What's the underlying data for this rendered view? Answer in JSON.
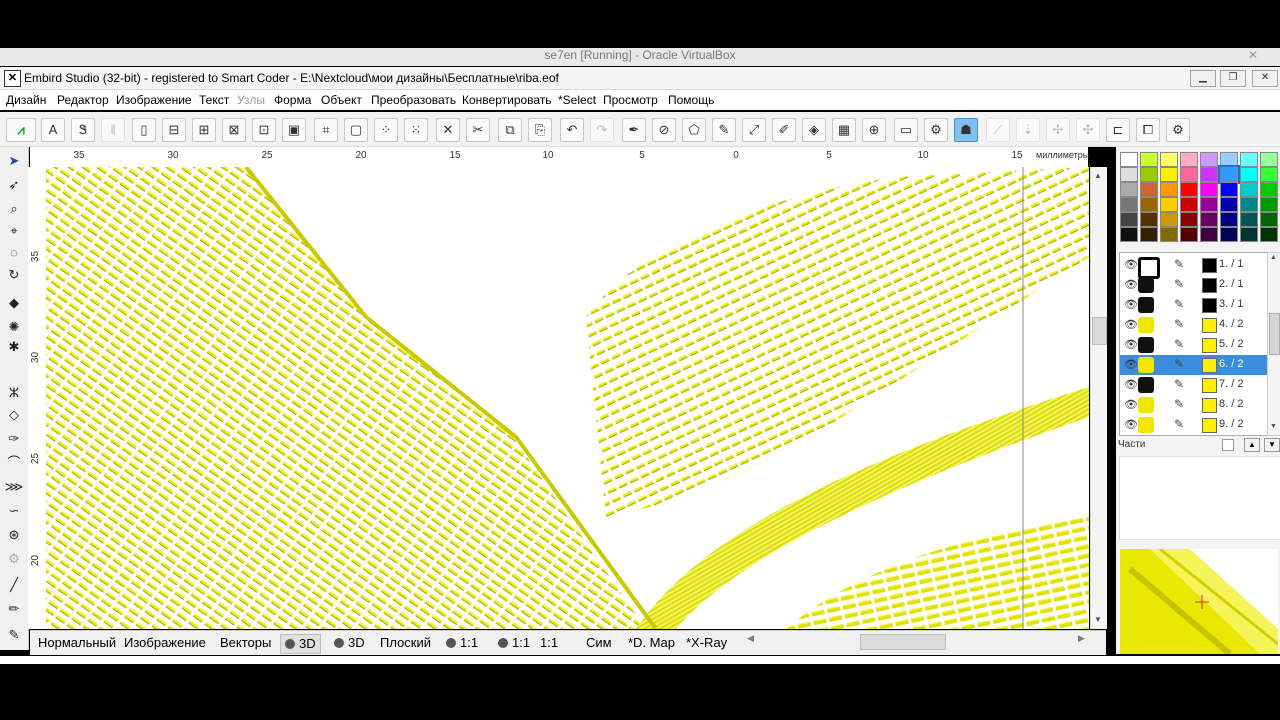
{
  "vbox_title": "se7en [Running] - Oracle VirtualBox",
  "window": {
    "title": "Embird Studio (32-bit) -  registered to Smart Coder - E:\\Nextcloud\\мои дизайны\\Бесплатные\\riba.eof"
  },
  "menu": [
    "Дизайн",
    "Редактор",
    "Изображение",
    "Текст",
    "Узлы",
    "Форма",
    "Объект",
    "Преобразовать",
    "Конвертировать",
    "*Select",
    "Просмотр",
    "Помощь"
  ],
  "ruler": {
    "top_ticks": [
      "35",
      "30",
      "25",
      "20",
      "15",
      "10",
      "5",
      "0",
      "5",
      "10",
      "15"
    ],
    "unit": "миллиметры",
    "left_ticks": [
      "35",
      "30",
      "25",
      "20"
    ]
  },
  "status_tabs": {
    "normal": "Нормальный",
    "image": "Изображение",
    "vectors": "Векторы",
    "three_d_a": "3D",
    "three_d_b": "3D",
    "flat": "Плоский",
    "ratio_a": "1:1",
    "ratio_b": "1:1",
    "ratio_c": "1:1",
    "sim": "Сим",
    "dmap": "*D. Map",
    "xray": "*X-Ray"
  },
  "objects": [
    {
      "label": "1. / 1",
      "color": "#000000",
      "thumb": "ring",
      "selected": false
    },
    {
      "label": "2. / 1",
      "color": "#000000",
      "thumb": "dark",
      "selected": false
    },
    {
      "label": "3. / 1",
      "color": "#000000",
      "thumb": "dark",
      "selected": false
    },
    {
      "label": "4. / 2",
      "color": "#ffee00",
      "thumb": "yellow",
      "selected": false
    },
    {
      "label": "5. / 2",
      "color": "#ffee00",
      "thumb": "dark",
      "selected": false
    },
    {
      "label": "6. / 2",
      "color": "#ffee00",
      "thumb": "yellow",
      "selected": true
    },
    {
      "label": "7. / 2",
      "color": "#ffee00",
      "thumb": "dark",
      "selected": false
    },
    {
      "label": "8. / 2",
      "color": "#ffee00",
      "thumb": "yellow",
      "selected": false
    },
    {
      "label": "9. / 2",
      "color": "#ffee00",
      "thumb": "yellow",
      "selected": false
    }
  ],
  "parts_label": "Части",
  "colors": {
    "accent": "#3a8ddc",
    "thread": "#e6e600"
  }
}
